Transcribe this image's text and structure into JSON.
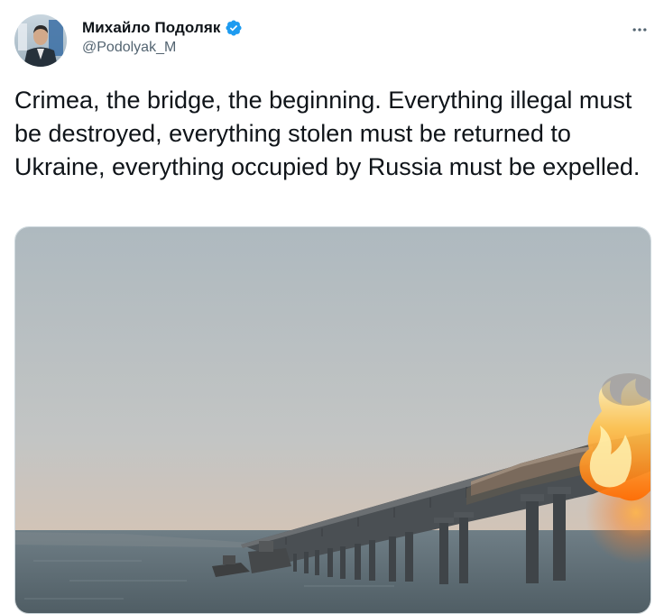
{
  "tweet": {
    "author": {
      "display_name": "Михайло Подоляк",
      "handle": "@Podolyak_M",
      "verified": true
    },
    "text": "Crimea, the bridge, the beginning. Everything illegal must be destroyed, everything stolen must be returned to Ukraine, everything occupied by Russia must be expelled.",
    "media": {
      "icon": "photo-bridge-fire"
    }
  },
  "colors": {
    "name_text": "#0f1419",
    "secondary_text": "#536471",
    "verified_blue": "#1d9bf0",
    "media_border": "#cfd9de"
  },
  "icons": {
    "more": "more-horizontal-icon",
    "verified": "verified-badge-icon"
  }
}
